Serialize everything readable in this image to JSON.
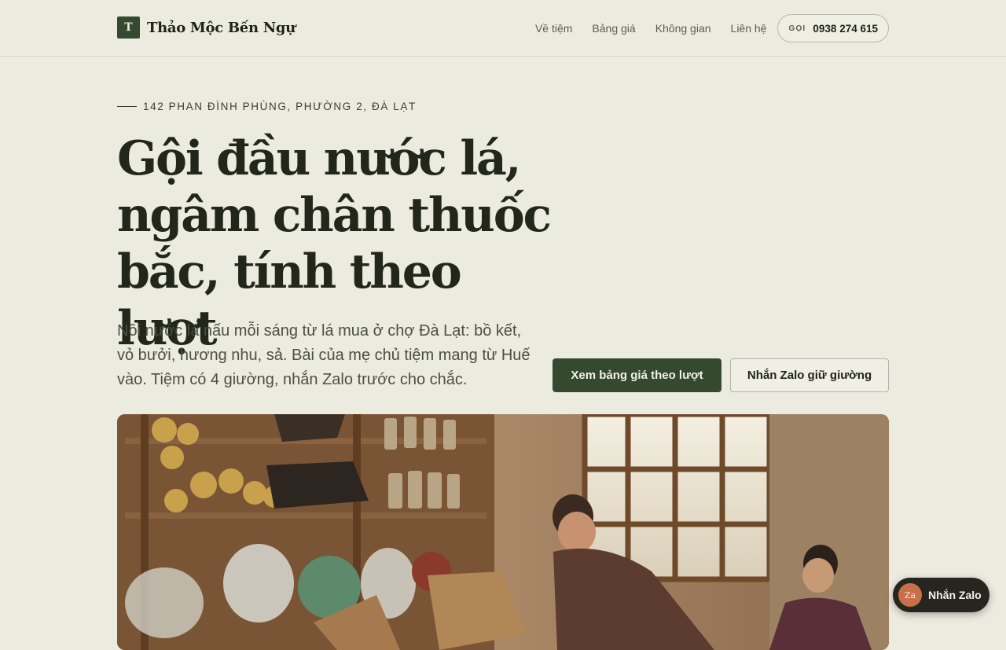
{
  "header": {
    "brand_mark": "T",
    "brand_name": "Thảo Mộc Bến Ngự",
    "nav": [
      "Về tiệm",
      "Bảng giá",
      "Không gian",
      "Liên hệ"
    ],
    "call_tag": "GỌI",
    "call_number": "0938 274 615"
  },
  "hero": {
    "eyebrow": "142 PHAN ĐÌNH PHÙNG, PHƯỜNG 2, ĐÀ LẠT",
    "headline": "Gội đầu nước lá, ngâm chân thuốc bắc, tính theo lượt",
    "lead": "Nồi nước lá nấu mỗi sáng từ lá mua ở chợ Đà Lạt: bồ kết, vỏ bưởi, hương nhu, sả. Bài của mẹ chủ tiệm mang từ Huế vào. Tiệm có 4 giường, nhắn Zalo trước cho chắc.",
    "cta_primary": "Xem bảng giá theo lượt",
    "cta_secondary": "Nhắn Zalo giữ giường"
  },
  "floating": {
    "badge": "Za",
    "label": "Nhắn Zalo"
  },
  "colors": {
    "background": "#ecebdf",
    "accent": "#34492f",
    "text": "#1f2318",
    "zalo_badge": "#c8704a"
  }
}
